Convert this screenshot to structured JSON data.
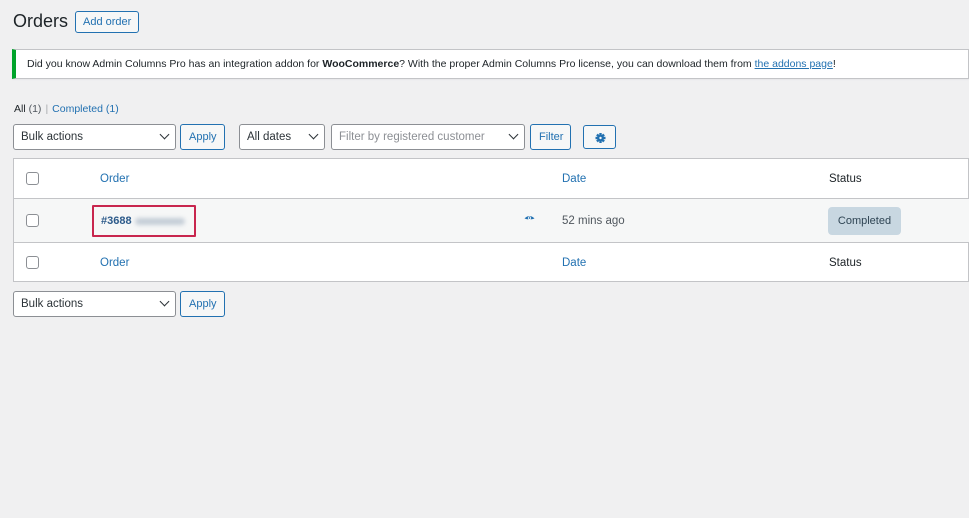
{
  "page": {
    "title": "Orders",
    "add_order_label": "Add order"
  },
  "notice": {
    "text_before": "Did you know Admin Columns Pro has an integration addon for ",
    "strong": "WooCommerce",
    "text_middle": "? With the proper Admin Columns Pro license, you can download them from ",
    "link": "the addons page",
    "text_after": "!"
  },
  "views": {
    "all_label": "All",
    "all_count": "(1)",
    "separator": "|",
    "completed_label": "Completed",
    "completed_count": "(1)"
  },
  "filters": {
    "bulk_actions": "Bulk actions",
    "apply": "Apply",
    "dates": "All dates",
    "customer_placeholder": "Filter by registered customer",
    "filter": "Filter"
  },
  "table": {
    "headers": {
      "order": "Order",
      "date": "Date",
      "status": "Status"
    },
    "rows": [
      {
        "order_number": "#3688",
        "date": "52 mins ago",
        "status": "Completed"
      }
    ]
  },
  "bottom": {
    "bulk_actions": "Bulk actions",
    "apply": "Apply"
  },
  "colors": {
    "accent": "#2271b1",
    "notice_border": "#00a32a",
    "highlight_border": "#c8264e",
    "status_completed_bg": "#c8d7e1"
  },
  "icons": [
    "chevron-down-icon",
    "gear-icon",
    "eye-icon"
  ]
}
